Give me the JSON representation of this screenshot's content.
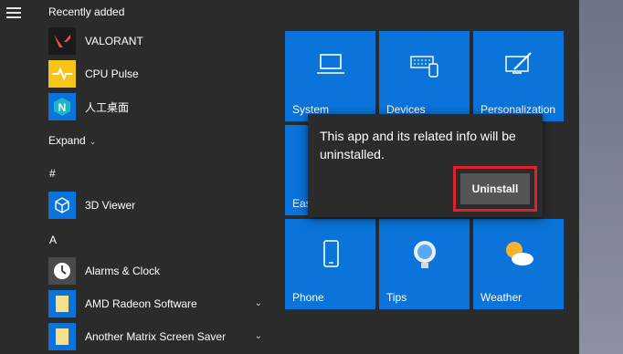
{
  "sections": {
    "recently_added": "Recently added",
    "hash": "#",
    "letter_a": "A",
    "expand": "Expand"
  },
  "apps": [
    {
      "label": "VALORANT",
      "icon": "valorant-icon"
    },
    {
      "label": "CPU Pulse",
      "icon": "cpu-pulse-icon"
    },
    {
      "label": "人工桌面",
      "icon": "n-app-icon"
    },
    {
      "label": "3D Viewer",
      "icon": "cube-icon"
    },
    {
      "label": "Alarms & Clock",
      "icon": "clock-icon"
    },
    {
      "label": "AMD Radeon Software",
      "icon": "folder-icon"
    },
    {
      "label": "Another Matrix Screen Saver",
      "icon": "folder-icon"
    }
  ],
  "tiles": [
    {
      "label": "System",
      "icon": "laptop-icon"
    },
    {
      "label": "Devices",
      "icon": "keyboard-icon"
    },
    {
      "label": "Personalization",
      "icon": "paint-icon"
    },
    {
      "label": "Eas",
      "icon": ""
    },
    {
      "label": "Phone",
      "icon": "phone-icon"
    },
    {
      "label": "Tips",
      "icon": "lightbulb-icon"
    },
    {
      "label": "Weather",
      "icon": "weather-icon"
    }
  ],
  "dialog": {
    "message": "This app and its related info will be uninstalled.",
    "uninstall_label": "Uninstall"
  },
  "colors": {
    "tile_blue": "#0a74da",
    "menu_bg": "#2b2b2b",
    "highlight_red": "#e2202c"
  }
}
